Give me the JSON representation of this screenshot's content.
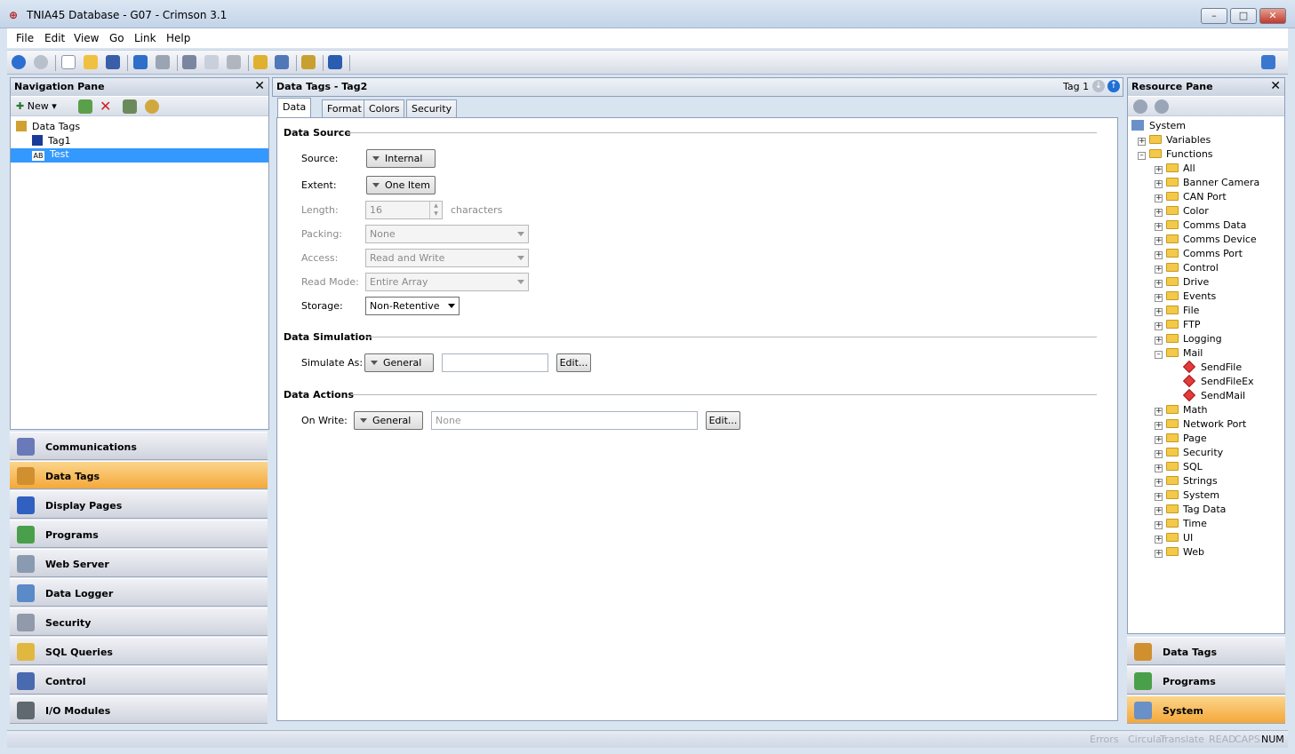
{
  "window": {
    "title": "TNIA45 Database - G07 - Crimson 3.1"
  },
  "menu": [
    "File",
    "Edit",
    "View",
    "Go",
    "Link",
    "Help"
  ],
  "nav": {
    "title": "Navigation Pane",
    "new_label": "New",
    "tree": {
      "root": "Data Tags",
      "items": [
        "Tag1",
        "Test"
      ],
      "selected": "Test"
    },
    "categories": [
      "Communications",
      "Data Tags",
      "Display Pages",
      "Programs",
      "Web Server",
      "Data Logger",
      "Security",
      "SQL Queries",
      "Control",
      "I/O Modules"
    ],
    "active_category": "Data Tags"
  },
  "editor": {
    "header": "Data Tags - Tag2",
    "nav_label": "Tag 1",
    "tabs": [
      "Data",
      "Format",
      "Colors",
      "Security"
    ],
    "active_tab": "Data",
    "data_source": {
      "heading": "Data Source",
      "source_label": "Source:",
      "source_value": "Internal",
      "extent_label": "Extent:",
      "extent_value": "One Item",
      "length_label": "Length:",
      "length_value": "16",
      "length_unit": "characters",
      "packing_label": "Packing:",
      "packing_value": "None",
      "access_label": "Access:",
      "access_value": "Read and Write",
      "readmode_label": "Read Mode:",
      "readmode_value": "Entire Array",
      "storage_label": "Storage:",
      "storage_value": "Non-Retentive"
    },
    "data_simulation": {
      "heading": "Data Simulation",
      "simulate_label": "Simulate As:",
      "simulate_value": "General",
      "simulate_text": "",
      "edit_label": "Edit..."
    },
    "data_actions": {
      "heading": "Data Actions",
      "onwrite_label": "On Write:",
      "onwrite_value": "General",
      "onwrite_placeholder": "None",
      "edit_label": "Edit..."
    }
  },
  "resource": {
    "title": "Resource Pane",
    "root": "System",
    "variables": "Variables",
    "functions": "Functions",
    "function_groups": [
      "All",
      "Banner Camera",
      "CAN Port",
      "Color",
      "Comms Data",
      "Comms Device",
      "Comms Port",
      "Control",
      "Drive",
      "Events",
      "File",
      "FTP",
      "Logging",
      "Mail"
    ],
    "mail_items": [
      "SendFile",
      "SendFileEx",
      "SendMail"
    ],
    "function_groups_after": [
      "Math",
      "Network Port",
      "Page",
      "Security",
      "SQL",
      "Strings",
      "System",
      "Tag Data",
      "Time",
      "UI",
      "Web"
    ],
    "categories": [
      "Data Tags",
      "Programs",
      "System"
    ],
    "active_category": "System"
  },
  "status": [
    "Errors",
    "Circular",
    "Translate",
    "READ",
    "CAPS",
    "NUM"
  ]
}
